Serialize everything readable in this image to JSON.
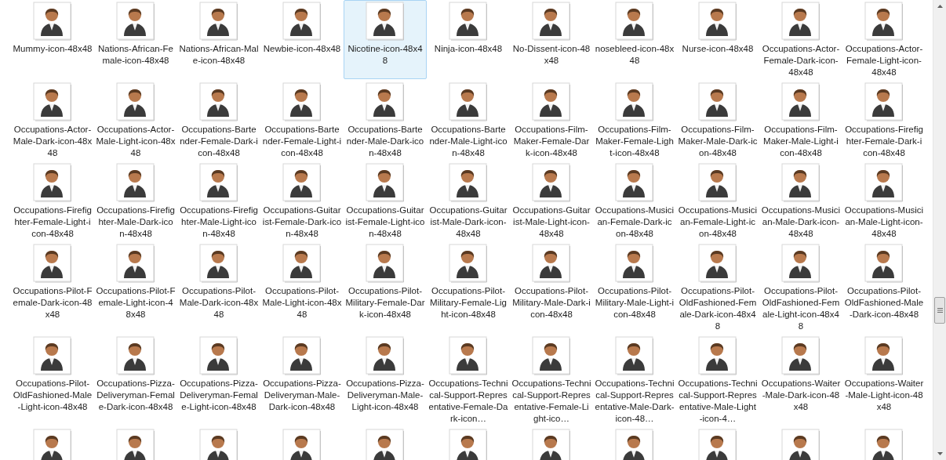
{
  "view": {
    "items": [
      {
        "label": "Mummy-icon-48x48",
        "selected": false
      },
      {
        "label": "Nations-African-Female-icon-48x48",
        "selected": false
      },
      {
        "label": "Nations-African-Male-icon-48x48",
        "selected": false
      },
      {
        "label": "Newbie-icon-48x48",
        "selected": false
      },
      {
        "label": "Nicotine-icon-48x48",
        "selected": true
      },
      {
        "label": "Ninja-icon-48x48",
        "selected": false
      },
      {
        "label": "No-Dissent-icon-48x48",
        "selected": false
      },
      {
        "label": "nosebleed-icon-48x48",
        "selected": false
      },
      {
        "label": "Nurse-icon-48x48",
        "selected": false
      },
      {
        "label": "Occupations-Actor-Female-Dark-icon-48x48",
        "selected": false
      },
      {
        "label": "Occupations-Actor-Female-Light-icon-48x48",
        "selected": false
      },
      {
        "label": "Occupations-Actor-Male-Dark-icon-48x48",
        "selected": false
      },
      {
        "label": "Occupations-Actor-Male-Light-icon-48x48",
        "selected": false
      },
      {
        "label": "Occupations-Bartender-Female-Dark-icon-48x48",
        "selected": false
      },
      {
        "label": "Occupations-Bartender-Female-Light-icon-48x48",
        "selected": false
      },
      {
        "label": "Occupations-Bartender-Male-Dark-icon-48x48",
        "selected": false
      },
      {
        "label": "Occupations-Bartender-Male-Light-icon-48x48",
        "selected": false
      },
      {
        "label": "Occupations-Film-Maker-Female-Dark-icon-48x48",
        "selected": false
      },
      {
        "label": "Occupations-Film-Maker-Female-Light-icon-48x48",
        "selected": false
      },
      {
        "label": "Occupations-Film-Maker-Male-Dark-icon-48x48",
        "selected": false
      },
      {
        "label": "Occupations-Film-Maker-Male-Light-icon-48x48",
        "selected": false
      },
      {
        "label": "Occupations-Firefighter-Female-Dark-icon-48x48",
        "selected": false
      },
      {
        "label": "Occupations-Firefighter-Female-Light-icon-48x48",
        "selected": false
      },
      {
        "label": "Occupations-Firefighter-Male-Dark-icon-48x48",
        "selected": false
      },
      {
        "label": "Occupations-Firefighter-Male-Light-icon-48x48",
        "selected": false
      },
      {
        "label": "Occupations-Guitarist-Female-Dark-icon-48x48",
        "selected": false
      },
      {
        "label": "Occupations-Guitarist-Female-Light-icon-48x48",
        "selected": false
      },
      {
        "label": "Occupations-Guitarist-Male-Dark-icon-48x48",
        "selected": false
      },
      {
        "label": "Occupations-Guitarist-Male-Light-icon-48x48",
        "selected": false
      },
      {
        "label": "Occupations-Musician-Female-Dark-icon-48x48",
        "selected": false
      },
      {
        "label": "Occupations-Musician-Female-Light-icon-48x48",
        "selected": false
      },
      {
        "label": "Occupations-Musician-Male-Dark-icon-48x48",
        "selected": false
      },
      {
        "label": "Occupations-Musician-Male-Light-icon-48x48",
        "selected": false
      },
      {
        "label": "Occupations-Pilot-Female-Dark-icon-48x48",
        "selected": false
      },
      {
        "label": "Occupations-Pilot-Female-Light-icon-48x48",
        "selected": false
      },
      {
        "label": "Occupations-Pilot-Male-Dark-icon-48x48",
        "selected": false
      },
      {
        "label": "Occupations-Pilot-Male-Light-icon-48x48",
        "selected": false
      },
      {
        "label": "Occupations-Pilot-Military-Female-Dark-icon-48x48",
        "selected": false
      },
      {
        "label": "Occupations-Pilot-Military-Female-Light-icon-48x48",
        "selected": false
      },
      {
        "label": "Occupations-Pilot-Military-Male-Dark-icon-48x48",
        "selected": false
      },
      {
        "label": "Occupations-Pilot-Military-Male-Light-icon-48x48",
        "selected": false
      },
      {
        "label": "Occupations-Pilot-OldFashioned-Female-Dark-icon-48x48",
        "selected": false
      },
      {
        "label": "Occupations-Pilot-OldFashioned-Female-Light-icon-48x48",
        "selected": false
      },
      {
        "label": "Occupations-Pilot-OldFashioned-Male-Dark-icon-48x48",
        "selected": false
      },
      {
        "label": "Occupations-Pilot-OldFashioned-Male-Light-icon-48x48",
        "selected": false
      },
      {
        "label": "Occupations-Pizza-Deliveryman-Female-Dark-icon-48x48",
        "selected": false
      },
      {
        "label": "Occupations-Pizza-Deliveryman-Female-Light-icon-48x48",
        "selected": false
      },
      {
        "label": "Occupations-Pizza-Deliveryman-Male-Dark-icon-48x48",
        "selected": false
      },
      {
        "label": "Occupations-Pizza-Deliveryman-Male-Light-icon-48x48",
        "selected": false
      },
      {
        "label": "Occupations-Technical-Support-Representative-Female-Dark-icon…",
        "selected": false
      },
      {
        "label": "Occupations-Technical-Support-Representative-Female-Light-ico…",
        "selected": false
      },
      {
        "label": "Occupations-Technical-Support-Representative-Male-Dark-icon-48…",
        "selected": false
      },
      {
        "label": "Occupations-Technical-Support-Representative-Male-Light-icon-4…",
        "selected": false
      },
      {
        "label": "Occupations-Waiter-Male-Dark-icon-48x48",
        "selected": false
      },
      {
        "label": "Occupations-Waiter-Male-Light-icon-48x48",
        "selected": false
      },
      {
        "selected": false
      },
      {
        "selected": false
      },
      {
        "selected": false
      },
      {
        "selected": false
      },
      {
        "selected": false
      },
      {
        "selected": false
      },
      {
        "selected": false
      },
      {
        "selected": false
      },
      {
        "selected": false
      },
      {
        "selected": false
      },
      {
        "selected": false
      }
    ]
  }
}
